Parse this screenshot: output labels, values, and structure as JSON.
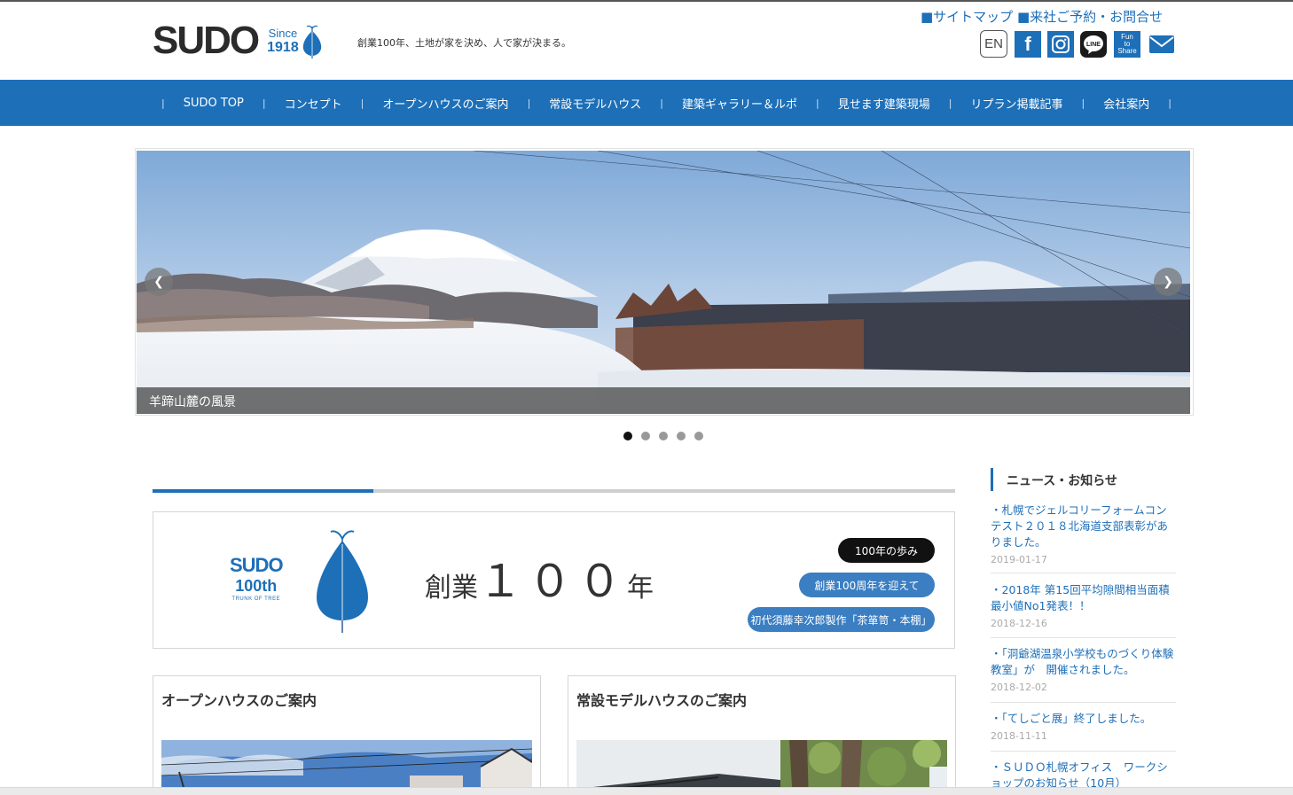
{
  "header": {
    "logo_text": "SUDO",
    "since_label": "Since",
    "since_year": "1918",
    "tagline": "創業100年、土地が家を決め、人で家が決まる。",
    "sitemap_link": "■サイトマップ",
    "contact_link": "■来社ご予約・お問合せ",
    "social": {
      "en_label": "EN",
      "facebook_icon": "facebook-icon",
      "instagram_icon": "instagram-icon",
      "line_label": "LINE",
      "fun_label_1": "Fun",
      "fun_label_2": "to",
      "fun_label_3": "Share",
      "mail_icon": "mail-icon"
    }
  },
  "nav": {
    "items": [
      {
        "label": "SUDO TOP"
      },
      {
        "label": "コンセプト"
      },
      {
        "label": "オープンハウスのご案内"
      },
      {
        "label": "常設モデルハウス"
      },
      {
        "label": "建築ギャラリー＆ルポ"
      },
      {
        "label": "見せます建築現場"
      },
      {
        "label": "リプラン掲載記事"
      },
      {
        "label": "会社案内"
      }
    ]
  },
  "slider": {
    "caption": "羊蹄山麓の風景",
    "prev_icon": "chevron-left-icon",
    "next_icon": "chevron-right-icon",
    "dot_count": 5,
    "active_index": 0
  },
  "main": {
    "progress_fraction": 0.275,
    "anniversary": {
      "logo_sudo": "SUDO",
      "logo_100th": "100th",
      "logo_sub": "TRUNK OF TREE",
      "title_prefix": "創業",
      "title_number": "１００",
      "title_suffix": "年",
      "button_history": "100年の歩み",
      "button_welcome": "創業100周年を迎えて",
      "button_craft": "初代須藤幸次郎製作「茶箪笥・本棚」"
    },
    "cards": [
      {
        "title": "オープンハウスのご案内"
      },
      {
        "title": "常設モデルハウスのご案内"
      }
    ]
  },
  "sidebar": {
    "news_heading": "ニュース・お知らせ",
    "news": [
      {
        "text": "・札幌でジェルコリーフォームコンテスト２０１８北海道支部表彰がありました。",
        "date": "2019-01-17"
      },
      {
        "text": "・2018年 第15回平均隙間相当面積最小値No1発表！！",
        "date": "2018-12-16"
      },
      {
        "text": "・「洞爺湖温泉小学校ものづくり体験教室」が　開催されました。",
        "date": "2018-12-02"
      },
      {
        "text": "・「てしごと展」終了しました。",
        "date": "2018-11-11"
      },
      {
        "text": "・ＳＵＤＯ札幌オフィス　ワークショップのお知らせ（10月）",
        "date": ""
      }
    ]
  },
  "colors": {
    "brand_blue": "#1d6fb8",
    "pill_blue": "#3b7ec2",
    "text_dark": "#333333"
  }
}
